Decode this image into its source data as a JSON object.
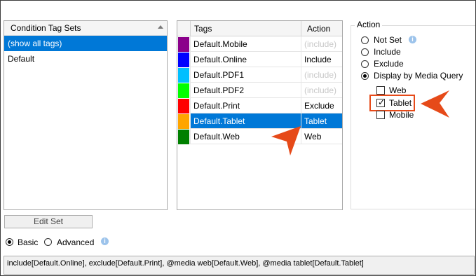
{
  "sets_panel": {
    "header": "Condition Tag Sets",
    "items": [
      {
        "label": "(show all tags)",
        "selected": true
      },
      {
        "label": "Default",
        "selected": false
      }
    ]
  },
  "tags_table": {
    "headers": {
      "tags": "Tags",
      "action": "Action"
    },
    "rows": [
      {
        "name": "Default.Mobile",
        "color": "#8b008b",
        "action": "(include)",
        "dim": true
      },
      {
        "name": "Default.Online",
        "color": "#0000ff",
        "action": "Include",
        "dim": false
      },
      {
        "name": "Default.PDF1",
        "color": "#00bfff",
        "action": "(include)",
        "dim": true
      },
      {
        "name": "Default.PDF2",
        "color": "#00ff00",
        "action": "(include)",
        "dim": true
      },
      {
        "name": "Default.Print",
        "color": "#ff0000",
        "action": "Exclude",
        "dim": false
      },
      {
        "name": "Default.Tablet",
        "color": "#ffa500",
        "action": "Tablet",
        "dim": false,
        "selected": true
      },
      {
        "name": "Default.Web",
        "color": "#008000",
        "action": "Web",
        "dim": false
      }
    ]
  },
  "action_group": {
    "title": "Action",
    "options": [
      {
        "label": "Not Set",
        "checked": false
      },
      {
        "label": "Include",
        "checked": false
      },
      {
        "label": "Exclude",
        "checked": false
      },
      {
        "label": "Display by Media Query",
        "checked": true
      }
    ],
    "media": [
      {
        "label": "Web",
        "checked": false
      },
      {
        "label": "Tablet",
        "checked": true
      },
      {
        "label": "Mobile",
        "checked": false
      }
    ]
  },
  "edit_set_label": "Edit Set",
  "mode": {
    "basic": "Basic",
    "advanced": "Advanced",
    "selected": "basic"
  },
  "expression": "include[Default.Online], exclude[Default.Print], @media web[Default.Web], @media tablet[Default.Tablet]",
  "colors": {
    "selection": "#0078d7",
    "callout": "#e64a19",
    "info": "#9cc3eb"
  }
}
